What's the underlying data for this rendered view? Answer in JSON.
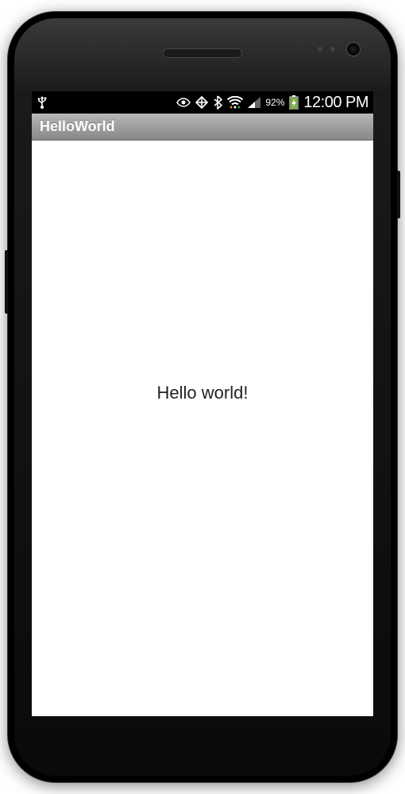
{
  "status_bar": {
    "battery_percent": "92%",
    "time": "12:00 PM"
  },
  "action_bar": {
    "title": "HelloWorld"
  },
  "content": {
    "message": "Hello world!"
  }
}
